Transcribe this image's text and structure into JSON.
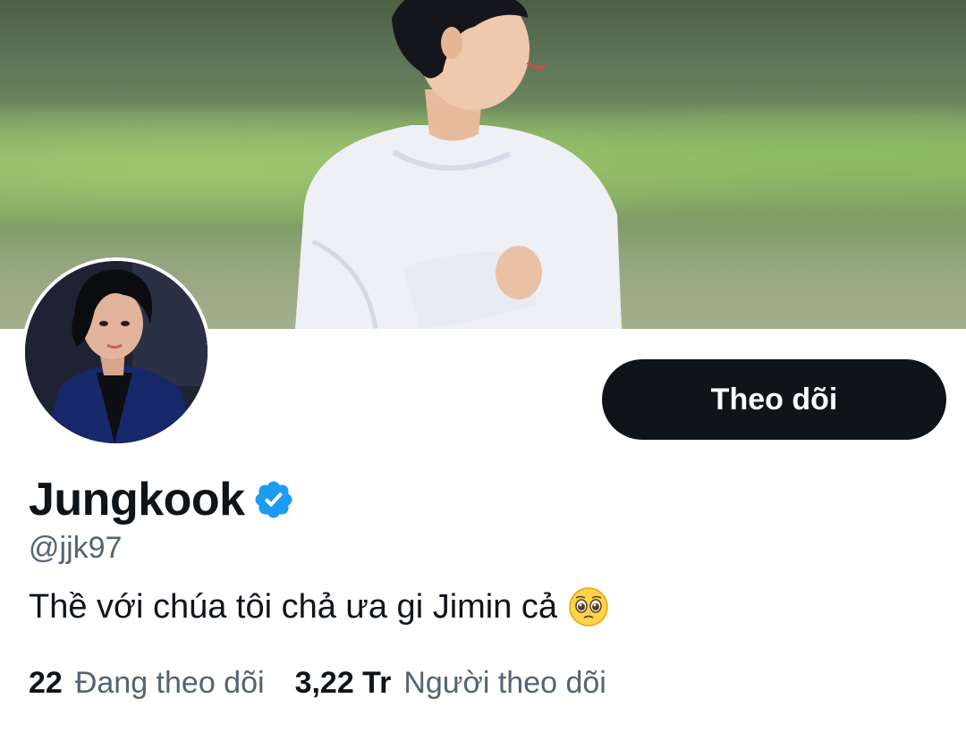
{
  "profile": {
    "display_name": "Jungkook",
    "handle": "@jjk97",
    "bio": "Thề với chúa tôi chả ưa gi Jimin cả",
    "verified": true,
    "bio_emoji": "pleading-face-icon"
  },
  "actions": {
    "follow_label": "Theo dõi"
  },
  "stats": {
    "following_count": "22",
    "following_label": "Đang theo dõi",
    "followers_count": "3,22 Tr",
    "followers_label": "Người theo dõi"
  },
  "colors": {
    "button_bg": "#0f1419",
    "verified_blue": "#1d9bf0",
    "secondary_text": "#536471",
    "primary_text": "#0f1419"
  }
}
